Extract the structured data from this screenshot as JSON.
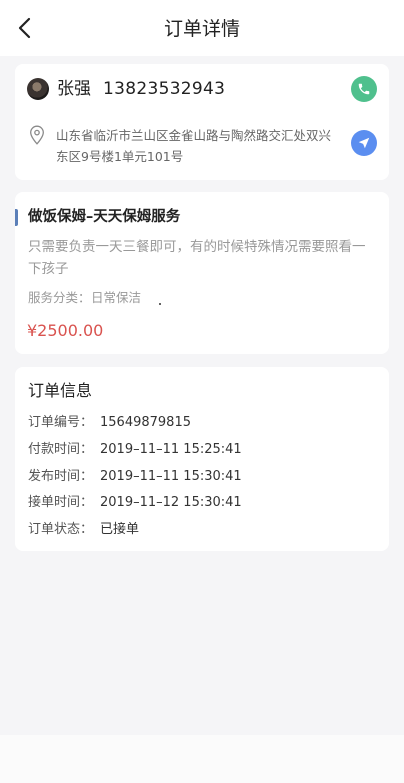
{
  "header": {
    "title": "订单详情",
    "back_icon": "chevron-left-icon"
  },
  "user": {
    "name": "张强",
    "phone": "13823532943",
    "address": "山东省临沂市兰山区金雀山路与陶然路交汇处双兴东区9号楼1单元101号",
    "call_icon": "phone-icon",
    "nav_icon": "navigation-icon",
    "location_icon": "location-pin-icon",
    "call_color": "#4fc08d",
    "nav_color": "#5b8ef0"
  },
  "service": {
    "title": "做饭保姆–天天保姆服务",
    "description": "只需要负责一天三餐即可，有的时候特殊情况需要照看一下孩子",
    "category_label": "服务分类：",
    "category_value": "日常保洁",
    "price": "¥2500.00",
    "price_color": "#d9534f",
    "accent_color": "#5b7fb8"
  },
  "order": {
    "heading": "订单信息",
    "rows": [
      {
        "label": "订单编号：",
        "value": "15649879815"
      },
      {
        "label": "付款时间：",
        "value": "2019–11–11 15:25:41"
      },
      {
        "label": "发布时间：",
        "value": "2019–11–11 15:30:41"
      },
      {
        "label": "接单时间：",
        "value": "2019–11–12 15:30:41"
      },
      {
        "label": "订单状态：",
        "value": "已接单"
      }
    ]
  }
}
